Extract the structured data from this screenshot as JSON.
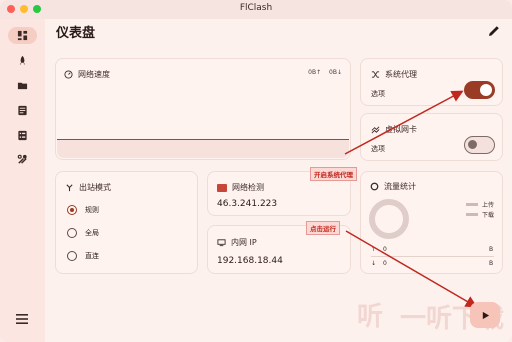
{
  "window": {
    "title": "FlClash"
  },
  "sidebar": {
    "items": [
      {
        "icon": "dashboard-icon",
        "active": true
      },
      {
        "icon": "rocket-icon"
      },
      {
        "icon": "folder-icon"
      },
      {
        "icon": "log-icon"
      },
      {
        "icon": "list-icon"
      },
      {
        "icon": "tools-icon"
      }
    ],
    "menu_icon": "menu-icon"
  },
  "header": {
    "title": "仪表盘",
    "edit_icon": "pencil-icon"
  },
  "network_speed": {
    "title": "网络速度",
    "upload": "0B↑",
    "download": "0B↓"
  },
  "system_proxy": {
    "title": "系统代理",
    "subtitle": "选项",
    "enabled": true
  },
  "virtual_nic": {
    "title": "虚拟网卡",
    "subtitle": "选项",
    "enabled": false
  },
  "outbound_mode": {
    "title": "出站模式",
    "options": [
      "规则",
      "全局",
      "直连"
    ],
    "selected": "规则"
  },
  "network_check": {
    "title": "网络检测",
    "value": "46.3.241.223"
  },
  "intranet_ip": {
    "title": "内网 IP",
    "value": "192.168.18.44"
  },
  "traffic": {
    "title": "流量统计",
    "legend_up": "上传",
    "legend_down": "下载",
    "rows": [
      {
        "arrow": "↑",
        "value": "0",
        "unit": "B"
      },
      {
        "arrow": "↓",
        "value": "0",
        "unit": "B"
      }
    ]
  },
  "annotations": {
    "proxy_note": "开启系统代理",
    "run_note": "点击运行"
  },
  "fab": {
    "icon": "play-icon"
  },
  "watermark": {
    "logo": "听",
    "text": "一听下载"
  },
  "colors": {
    "accent": "#9a3c25",
    "annotation": "#c0281e",
    "background": "#fdf1ee"
  }
}
